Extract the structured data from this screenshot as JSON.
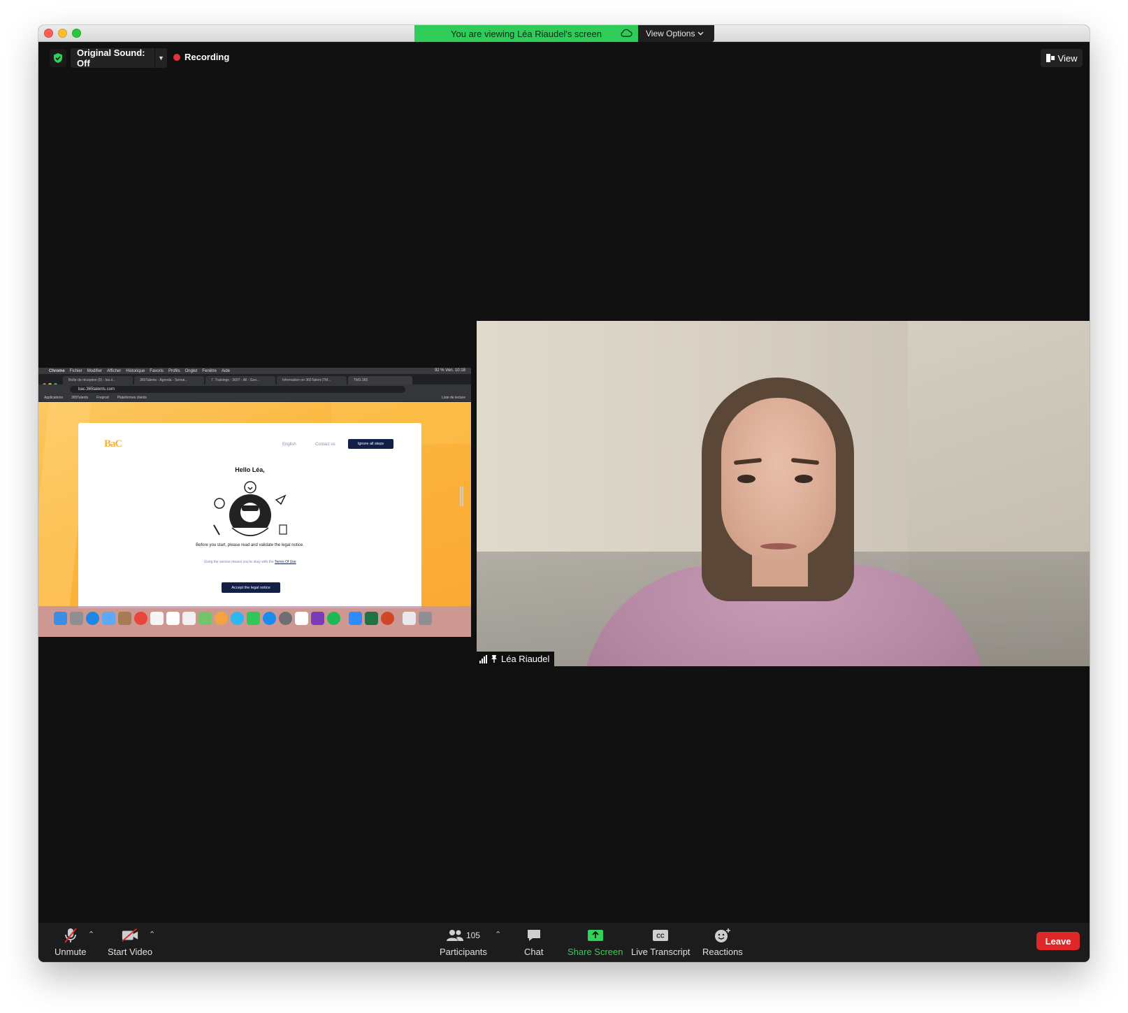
{
  "window": {
    "banner_text": "You are viewing Léa Riaudel's screen",
    "view_options_label": "View Options"
  },
  "topbar": {
    "original_sound_label": "Original Sound: Off",
    "recording_label": "Recording",
    "view_label": "View"
  },
  "shared_screen": {
    "mac_menu": [
      "Chrome",
      "Fichier",
      "Modifier",
      "Afficher",
      "Historique",
      "Favoris",
      "Profils",
      "Onglet",
      "Fenêtre",
      "Aide"
    ],
    "mac_status": "92 %   Ven. 10:18",
    "tabs": [
      "Boîte de réception (5) - lea.ri...",
      "365Talents - Agenda - Semai...",
      "7. Trainings - 365T - All - Goo...",
      "Information on 365Talent (TM...",
      "TMS 365"
    ],
    "url": "bac.365talents.com",
    "bookmarks": [
      "Applications",
      "365Talents",
      "Freprod",
      "Plateformes clients"
    ],
    "bookmarks_right": "Liste de lecture",
    "card": {
      "logo": "BaC",
      "language": "English",
      "contact": "Contact us",
      "ignore_button": "Ignore all steps",
      "greeting": "Hello Léa,",
      "instruction": "Before you start, please read and validate the legal notice.",
      "terms_prefix": "Using the service means you're okay with the",
      "terms_link": "Terms Of Use",
      "accept_button": "Accept the legal notice"
    }
  },
  "participant": {
    "name": "Léa Riaudel"
  },
  "toolbar": {
    "unmute": "Unmute",
    "start_video": "Start Video",
    "participants_count": "105",
    "participants": "Participants",
    "chat": "Chat",
    "share_screen": "Share Screen",
    "live_transcript": "Live Transcript",
    "reactions": "Reactions",
    "leave": "Leave"
  },
  "colors": {
    "banner_green": "#2fcc5a",
    "leave_red": "#e02828",
    "recording_red": "#e5323e",
    "share_green": "#2fd158",
    "card_navy": "#122048"
  }
}
